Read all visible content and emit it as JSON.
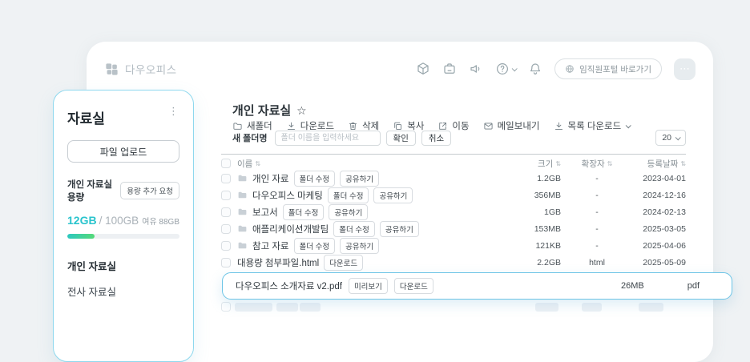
{
  "topbar": {
    "logo_text": "다우오피스",
    "icons": [
      {
        "id": "cube"
      },
      {
        "id": "archive"
      },
      {
        "id": "speaker"
      },
      {
        "id": "help",
        "chevron": true
      },
      {
        "id": "bell"
      }
    ],
    "portal_button": "임직원포털 바로가기",
    "avatar_glyph": "⋯"
  },
  "sidebar": {
    "title": "자료실",
    "more_glyph": "⋮",
    "upload_button": "파일 업로드",
    "quota_label": "개인 자료실 용량",
    "quota_request_button": "용량 추가 요청",
    "usage_used": "12GB",
    "usage_total": "/ 100GB",
    "usage_free": "여유 88GB",
    "progress_percent": 24,
    "menu": [
      {
        "id": "personal",
        "label": "개인 자료실",
        "active": true
      },
      {
        "id": "company",
        "label": "전사 자료실",
        "active": false
      }
    ]
  },
  "main": {
    "title": "개인 자료실",
    "star_glyph": "☆",
    "toolbar": [
      {
        "id": "new-folder",
        "label": "새폴더",
        "icon": "folder-icon"
      },
      {
        "id": "download",
        "label": "다운로드",
        "icon": "download-icon"
      },
      {
        "id": "delete",
        "label": "삭제",
        "icon": "trash-icon"
      },
      {
        "id": "copy",
        "label": "복사",
        "icon": "copy-icon"
      },
      {
        "id": "move",
        "label": "이동",
        "icon": "move-icon"
      },
      {
        "id": "send-mail",
        "label": "메일보내기",
        "icon": "mail-icon"
      },
      {
        "id": "list-download",
        "label": "목록 다운로드",
        "icon": "download-icon",
        "chevron": true
      }
    ],
    "new_folder_form": {
      "label": "새 폴더명",
      "placeholder": "폴더 이름을 입력하세요",
      "confirm_button": "확인",
      "cancel_button": "취소"
    },
    "page_size": "20",
    "table": {
      "headers": [
        "이름",
        "크기",
        "확장자",
        "등록날짜"
      ],
      "sort_glyph": "⇅",
      "rows": [
        {
          "name": "개인 자료",
          "type": "folder",
          "buttons": [
            "폴더 수정",
            "공유하기"
          ],
          "size": "1.2GB",
          "ext": "-",
          "date": "2023-04-01"
        },
        {
          "name": "다우오피스 마케팅",
          "type": "folder",
          "buttons": [
            "폴더 수정",
            "공유하기"
          ],
          "size": "356MB",
          "ext": "-",
          "date": "2024-12-16"
        },
        {
          "name": "보고서",
          "type": "folder",
          "buttons": [
            "폴더 수정",
            "공유하기"
          ],
          "size": "1GB",
          "ext": "-",
          "date": "2024-02-13"
        },
        {
          "name": "애플리케이션개발팀",
          "type": "folder",
          "buttons": [
            "폴더 수정",
            "공유하기"
          ],
          "size": "153MB",
          "ext": "-",
          "date": "2025-03-05"
        },
        {
          "name": "참고 자료",
          "type": "folder",
          "buttons": [
            "폴더 수정",
            "공유하기"
          ],
          "size": "121KB",
          "ext": "-",
          "date": "2025-04-06"
        },
        {
          "name": "대용량 첨부파일.html",
          "type": "file",
          "buttons": [
            "다운로드"
          ],
          "size": "2.2GB",
          "ext": "html",
          "date": "2025-05-09"
        }
      ]
    },
    "highlight_row": {
      "name": "다우오피스 소개자료 v2.pdf",
      "buttons": [
        "미리보기",
        "다운로드"
      ],
      "size": "26MB",
      "ext": "pdf"
    }
  },
  "colors": {
    "accent_teal": "#2ac4cd",
    "accent_cyan_border": "#6cc4e6",
    "progress_from": "#2cc8c0",
    "progress_to": "#55da78",
    "page_bg": "#eff2f4"
  }
}
